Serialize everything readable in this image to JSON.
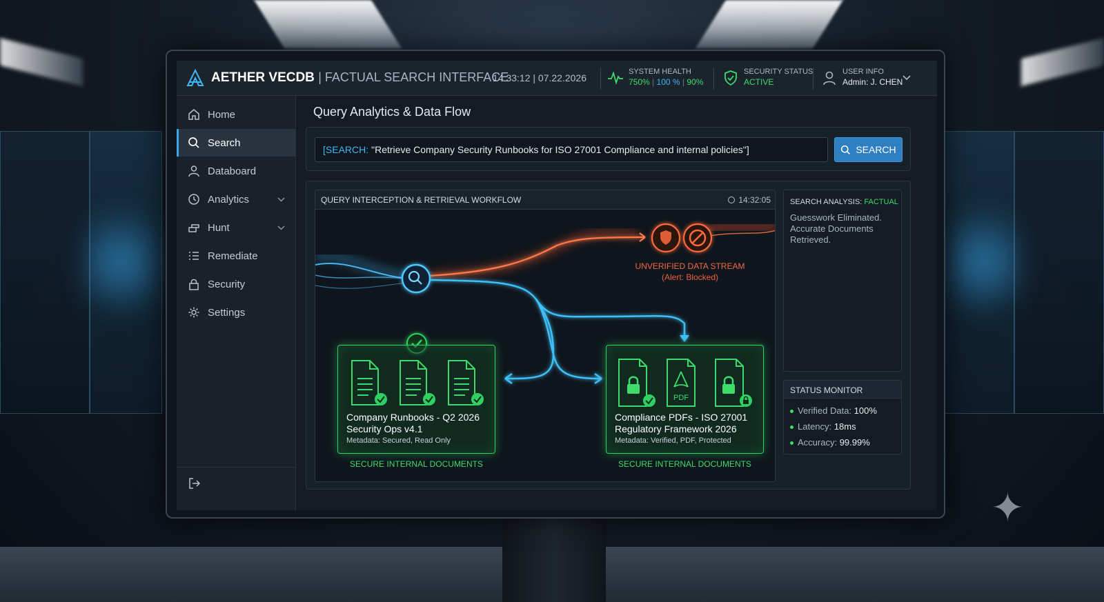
{
  "app": {
    "title": "AETHER VECDB",
    "subtitle": "| FACTUAL SEARCH INTERFACE",
    "datetime": "14:33:12 | 07.22.2026"
  },
  "header": {
    "system_health": {
      "label": "SYSTEM HEALTH",
      "v1": "750%",
      "sep": "|",
      "v2": "100 %",
      "v3": "90%"
    },
    "security_status": {
      "label": "SECURITY STATUS",
      "value": "ACTIVE"
    },
    "user_info": {
      "label": "USER INFO",
      "value": "Admin: J. CHEN"
    }
  },
  "sidebar": {
    "items": [
      {
        "label": "Home",
        "icon": "home-icon"
      },
      {
        "label": "Search",
        "icon": "search-icon",
        "active": true
      },
      {
        "label": "Databoard",
        "icon": "user-icon"
      },
      {
        "label": "Analytics",
        "icon": "clock-icon",
        "chevron": true
      },
      {
        "label": "Hunt",
        "icon": "hunt-icon",
        "chevron": true
      },
      {
        "label": "Remediate",
        "icon": "list-icon"
      },
      {
        "label": "Security",
        "icon": "lock-icon"
      },
      {
        "label": "Settings",
        "icon": "gear-icon"
      }
    ]
  },
  "main": {
    "page_title": "Query Analytics & Data Flow",
    "search": {
      "prefix": "[SEARCH:",
      "query": "\"Retrieve Company Security Runbooks for ISO 27001 Compliance and internal policies\"]",
      "button_label": "SEARCH"
    },
    "workflow": {
      "title": "QUERY INTERCEPTION & RETRIEVAL WORKFLOW",
      "time": "14:32:05",
      "alert_line1": "UNVERIFIED DATA STREAM",
      "alert_line2": "(Alert: Blocked)",
      "pdf_label": "PDF",
      "left_card": {
        "name_line1": "Company Runbooks - Q2 2026",
        "name_line2": "Security Ops v4.1",
        "meta": "Metadata: Secured, Read Only",
        "caption": "SECURE INTERNAL DOCUMENTS"
      },
      "right_card": {
        "name_line1": "Compliance PDFs - ISO 27001",
        "name_line2": "Regulatory Framework 2026",
        "meta": "Metadata: Verified, PDF, Protected",
        "caption": "SECURE INTERNAL DOCUMENTS"
      }
    },
    "analysis": {
      "label": "SEARCH ANALYSIS:",
      "value": "FACTUAL",
      "description": "Guesswork Eliminated. Accurate Documents Retrieved."
    },
    "status_monitor": {
      "title": "STATUS MONITOR",
      "rows": [
        {
          "label": "Verified Data:",
          "value": "100%"
        },
        {
          "label": "Latency:",
          "value": "18ms"
        },
        {
          "label": "Accuracy:",
          "value": "99.99%"
        }
      ]
    }
  },
  "colors": {
    "accent_blue": "#3db7f5",
    "success_green": "#3ddc6a",
    "alert_red": "#f06a45",
    "button_blue": "#2f80c3"
  }
}
